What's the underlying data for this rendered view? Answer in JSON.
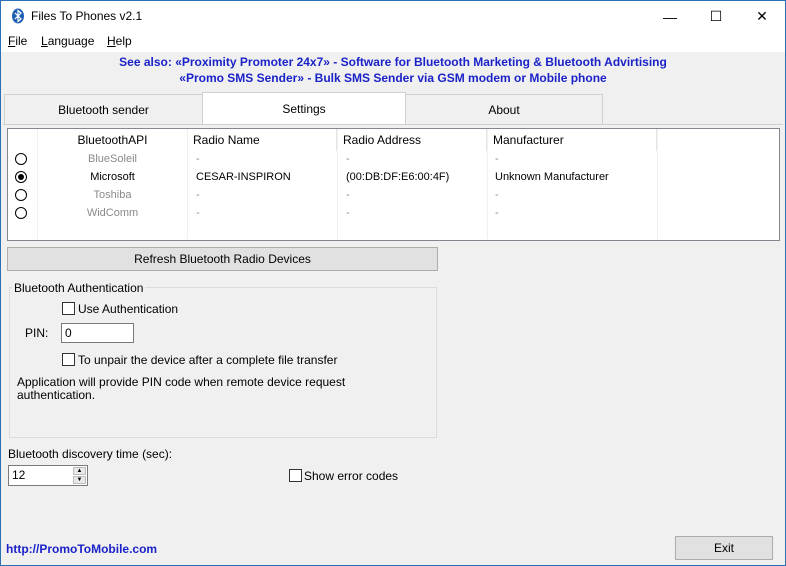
{
  "window": {
    "title": "Files To Phones v2.1",
    "controls": {
      "minimize": "—",
      "maximize": "☐",
      "close": "✕"
    }
  },
  "menu": {
    "file": "File",
    "language": "Language",
    "help": "Help"
  },
  "see_also": {
    "line1": "See also: «Proximity Promoter 24x7» - Software for Bluetooth Marketing & Bluetooth Advirtising",
    "line2": "«Promo SMS Sender» - Bulk SMS Sender via GSM modem or Mobile phone"
  },
  "tabs": [
    {
      "label": "Bluetooth sender"
    },
    {
      "label": "Settings",
      "active": true
    },
    {
      "label": "About"
    }
  ],
  "radio_table": {
    "columns": [
      "BluetoothAPI",
      "Radio Name",
      "Radio Address",
      "Manufacturer"
    ],
    "rows": [
      {
        "api": "BlueSoleil",
        "name": "-",
        "address": "-",
        "manufacturer": "-",
        "selected": false,
        "enabled": false
      },
      {
        "api": "Microsoft",
        "name": "CESAR-INSPIRON",
        "address": "(00:DB:DF:E6:00:4F)",
        "manufacturer": "Unknown Manufacturer",
        "selected": true,
        "enabled": true
      },
      {
        "api": "Toshiba",
        "name": "-",
        "address": "-",
        "manufacturer": "-",
        "selected": false,
        "enabled": false
      },
      {
        "api": "WidComm",
        "name": "-",
        "address": "-",
        "manufacturer": "-",
        "selected": false,
        "enabled": false
      }
    ]
  },
  "refresh_button": "Refresh Bluetooth Radio Devices",
  "auth": {
    "group_label": "Bluetooth Authentication",
    "use_auth_label": "Use Authentication",
    "use_auth_checked": false,
    "pin_label": "PIN:",
    "pin_value": "0",
    "unpair_label": "To unpair the device after a complete file transfer",
    "unpair_checked": false,
    "note_line1": "Application will provide PIN code when remote device request",
    "note_line2": "authentication."
  },
  "discovery": {
    "label": "Bluetooth discovery time (sec):",
    "value": "12"
  },
  "show_errors": {
    "label": "Show error codes",
    "checked": false
  },
  "footer": {
    "link": "http://PromoToMobile.com",
    "exit_button": "Exit"
  },
  "colors": {
    "link_blue": "#1a22c8",
    "accent_border": "#2b6fb5"
  },
  "icons": {
    "app": "bluetooth-icon"
  }
}
